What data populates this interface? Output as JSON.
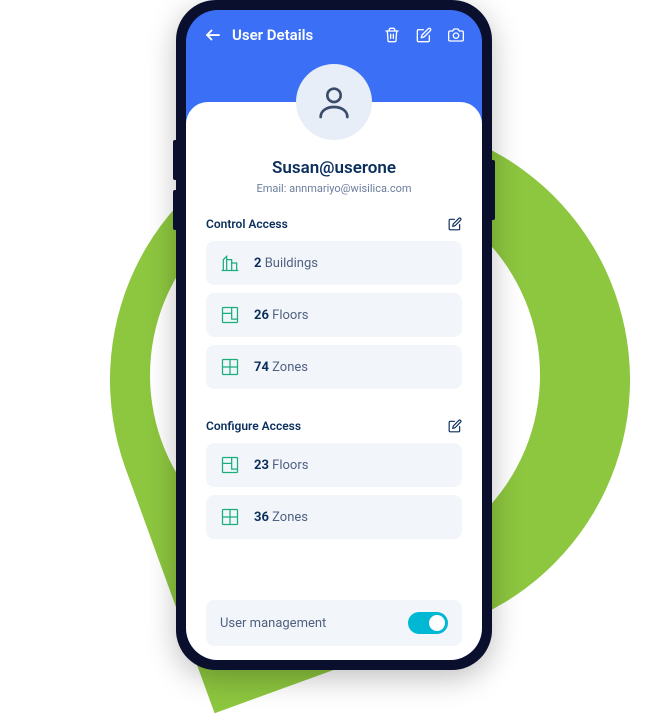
{
  "header": {
    "title": "User Details"
  },
  "profile": {
    "username": "Susan@userone",
    "email_label": "Email:",
    "email": "annmariyo@wisilica.com"
  },
  "control_access": {
    "title": "Control Access",
    "items": [
      {
        "count": "2",
        "label": "Buildings"
      },
      {
        "count": "26",
        "label": "Floors"
      },
      {
        "count": "74",
        "label": "Zones"
      }
    ]
  },
  "configure_access": {
    "title": "Configure Access",
    "items": [
      {
        "count": "23",
        "label": "Floors"
      },
      {
        "count": "36",
        "label": "Zones"
      }
    ]
  },
  "toggle": {
    "label": "User management",
    "on": true
  }
}
